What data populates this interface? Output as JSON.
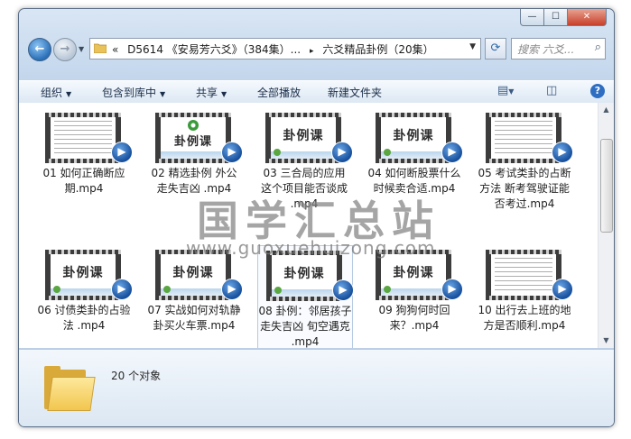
{
  "window": {
    "caption_buttons": [
      "minimize-icon",
      "maximize-icon",
      "close-icon"
    ]
  },
  "nav": {
    "address_prefix": "«",
    "breadcrumb_1": "D5614 《安易芳六爻》（384集）...",
    "separator": "▸",
    "breadcrumb_2": "六爻精品卦例（20集）",
    "search_placeholder": "搜索 六爻..."
  },
  "toolbar": {
    "organize": "组织",
    "include_in_library": "包含到库中",
    "share": "共享",
    "play_all": "全部播放",
    "new_folder": "新建文件夹"
  },
  "files": [
    {
      "name": "01 如何正确断应期.mp4",
      "thumb": "document"
    },
    {
      "name": "02 精选卦例 外公走失吉凶 .mp4",
      "thumb": "卦例课"
    },
    {
      "name": "03 三合局的应用 这个项目能否谈成 .mp4",
      "thumb": "卦例课"
    },
    {
      "name": "04 如何断股票什么时候卖合适.mp4",
      "thumb": "卦例课"
    },
    {
      "name": "05 考试类卦的占断方法 断考驾驶证能否考过.mp4",
      "thumb": "document"
    },
    {
      "name": "06 讨债类卦的占验法 .mp4",
      "thumb": "卦例课"
    },
    {
      "name": "07 实战如何对轨静卦买火车票.mp4",
      "thumb": "卦例课"
    },
    {
      "name": "08 卦例：邻居孩子走失吉凶 旬空遇克 .mp4",
      "thumb": "卦例课"
    },
    {
      "name": "09 狗狗何时回来？.mp4",
      "thumb": "卦例课"
    },
    {
      "name": "10 出行去上班的地方是否顺利.mp4",
      "thumb": "document"
    }
  ],
  "watermark": {
    "text": "国学汇总站",
    "url": "www.guoxuehuizong.com"
  },
  "details": {
    "count": "20 个对象"
  }
}
